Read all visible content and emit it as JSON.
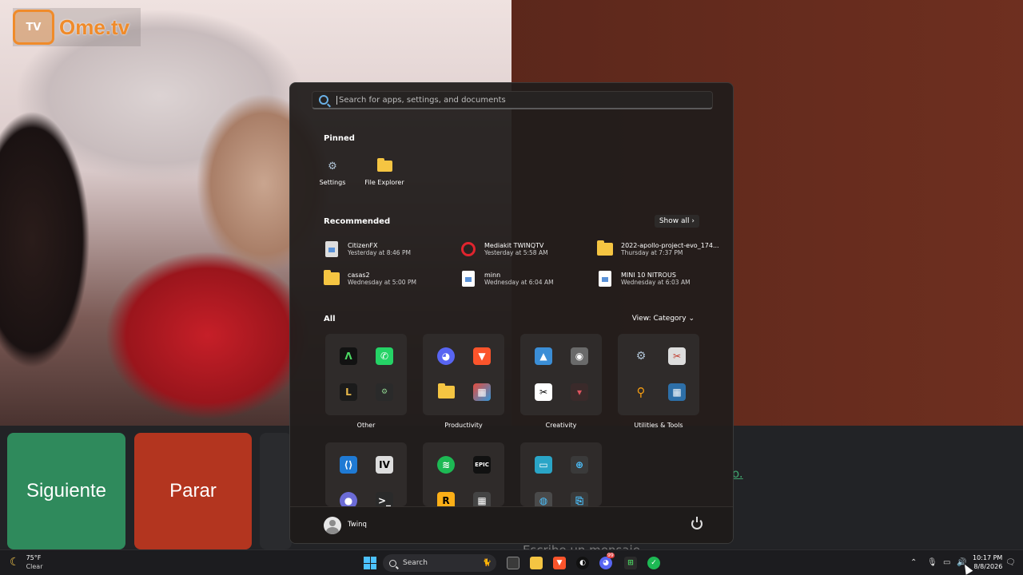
{
  "site": {
    "logo_badge": "Ome\nTV",
    "logo_text": "Ome.tv"
  },
  "chat": {
    "next_label": "Siguiente",
    "stop_label": "Parar",
    "link_fragment": "o.",
    "message_placeholder": "Escribe un mensaje"
  },
  "start_menu": {
    "search_placeholder": "Search for apps, settings, and documents",
    "pinned_title": "Pinned",
    "pinned": [
      {
        "label": "Settings",
        "icon": "gear-icon"
      },
      {
        "label": "File Explorer",
        "icon": "folder-icon"
      }
    ],
    "recommended_title": "Recommended",
    "show_all_label": "Show all",
    "recommended": [
      {
        "name": "CitizenFX",
        "date": "Yesterday at 8:46 PM",
        "icon": "file-icon"
      },
      {
        "name": "Mediakit TWINQTV",
        "date": "Yesterday at 5:58 AM",
        "icon": "opera-icon"
      },
      {
        "name": "2022-apollo-project-evo_174...",
        "date": "Thursday at 7:37 PM",
        "icon": "folder-icon"
      },
      {
        "name": "casas2",
        "date": "Wednesday at 5:00 PM",
        "icon": "folder-icon"
      },
      {
        "name": "minn",
        "date": "Wednesday at 6:04 AM",
        "icon": "document-icon"
      },
      {
        "name": "MINI 10 NITROUS",
        "date": "Wednesday at 6:03 AM",
        "icon": "document-icon"
      }
    ],
    "all_title": "All",
    "view_label": "View: Category",
    "groups": [
      {
        "label": "Other"
      },
      {
        "label": "Productivity"
      },
      {
        "label": "Creativity"
      },
      {
        "label": "Utilities & Tools"
      }
    ],
    "user_name": "Twinq"
  },
  "taskbar": {
    "temperature": "75°F",
    "condition": "Clear",
    "search_label": "Search",
    "time": "10:17 PM",
    "date": "8/8/2026",
    "notification_badge": "99"
  },
  "colors": {
    "next": "#2f8a5c",
    "stop": "#b3351f",
    "accent": "#4cc2ff",
    "brand": "#f08b2a"
  }
}
